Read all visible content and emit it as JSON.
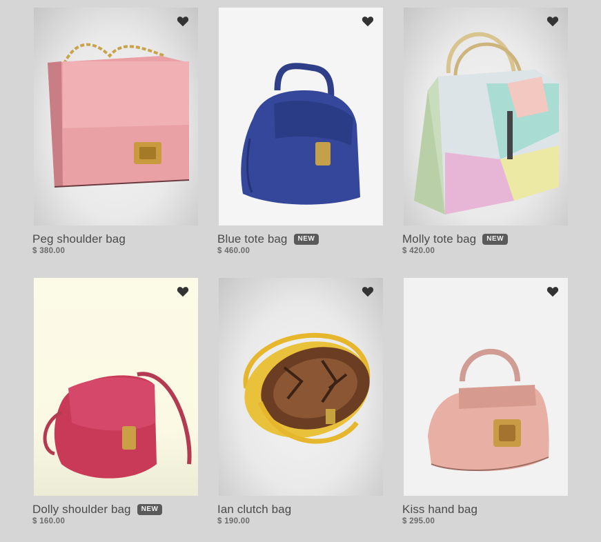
{
  "products": [
    {
      "name": "Peg shoulder bag",
      "price": "$ 380.00",
      "badge": "",
      "image": "pink-shoulder-bag",
      "favorite_icon": "heart-icon"
    },
    {
      "name": "Blue tote bag",
      "price": "$ 460.00",
      "badge": "NEW",
      "image": "blue-tote-bag",
      "favorite_icon": "heart-icon"
    },
    {
      "name": "Molly tote bag",
      "price": "$ 420.00",
      "badge": "NEW",
      "image": "pastel-tote-bag",
      "favorite_icon": "heart-icon"
    },
    {
      "name": "Dolly shoulder bag",
      "price": "$ 160.00",
      "badge": "NEW",
      "image": "red-saddle-bag",
      "favorite_icon": "heart-icon"
    },
    {
      "name": "Ian clutch bag",
      "price": "$ 190.00",
      "badge": "",
      "image": "yellow-round-clutch",
      "favorite_icon": "heart-icon"
    },
    {
      "name": "Kiss hand bag",
      "price": "$ 295.00",
      "badge": "",
      "image": "blush-hand-bag",
      "favorite_icon": "heart-icon"
    }
  ],
  "colors": {
    "page_background": "#d6d6d6",
    "text": "#4a4a4a",
    "badge_background": "#5a5a5a",
    "heart": "#333333"
  }
}
